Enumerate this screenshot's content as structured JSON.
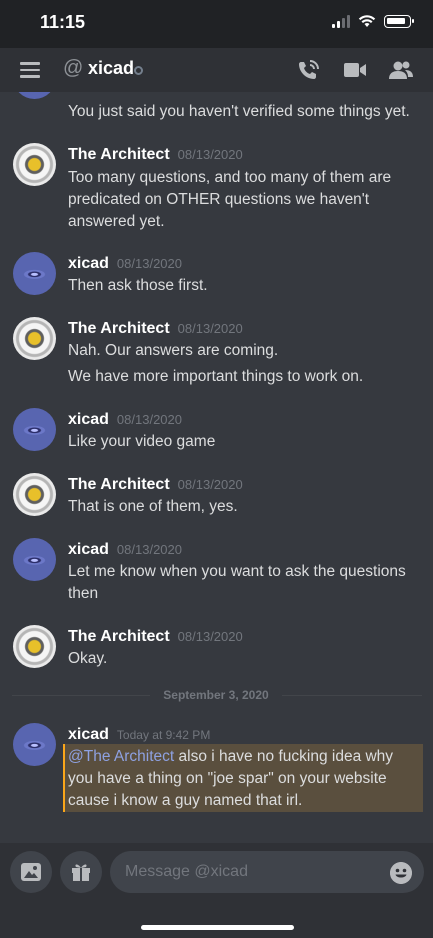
{
  "status_bar": {
    "time": "11:15"
  },
  "header": {
    "title": "xicad",
    "at_symbol": "@"
  },
  "messages": {
    "partial_top": {
      "text": "You just said you haven't verified some things yet."
    },
    "m1": {
      "author": "The Architect",
      "time": "08/13/2020",
      "lines": [
        "Too many questions, and too many of them are",
        "predicated on OTHER questions we haven't",
        "answered yet."
      ]
    },
    "m2": {
      "author": "xicad",
      "time": "08/13/2020",
      "lines": [
        "Then ask those first."
      ]
    },
    "m3": {
      "author": "The Architect",
      "time": "08/13/2020",
      "lines": [
        "Nah. Our answers are coming.",
        "We have more important things to work on."
      ]
    },
    "m4": {
      "author": "xicad",
      "time": "08/13/2020",
      "lines": [
        "Like your video game"
      ]
    },
    "m5": {
      "author": "The Architect",
      "time": "08/13/2020",
      "lines": [
        "That is one of them, yes."
      ]
    },
    "m6": {
      "author": "xicad",
      "time": "08/13/2020",
      "lines": [
        "Let me know when you want to ask the questions",
        "then"
      ]
    },
    "m7": {
      "author": "The Architect",
      "time": "08/13/2020",
      "lines": [
        "Okay."
      ]
    },
    "divider": "September 3, 2020",
    "m8": {
      "author": "xicad",
      "time": "Today at 9:42 PM",
      "mention": "@The Architect",
      "line1_rest": " also i have no fucking idea why",
      "lines": [
        "you have a thing on \"joe spar\" on your website",
        "cause i know a guy named that irl."
      ]
    }
  },
  "composer": {
    "placeholder": "Message @xicad"
  },
  "icons": [
    "menu-icon",
    "at-icon",
    "status-dot-icon",
    "call-icon",
    "video-icon",
    "members-icon",
    "image-icon",
    "gift-icon",
    "emoji-icon"
  ],
  "colors": {
    "background": "#36393f",
    "header": "#2f3136",
    "mention": "#8ea1e1",
    "highlight": "#5a4f3e",
    "highlight_border": "#faa61a"
  }
}
